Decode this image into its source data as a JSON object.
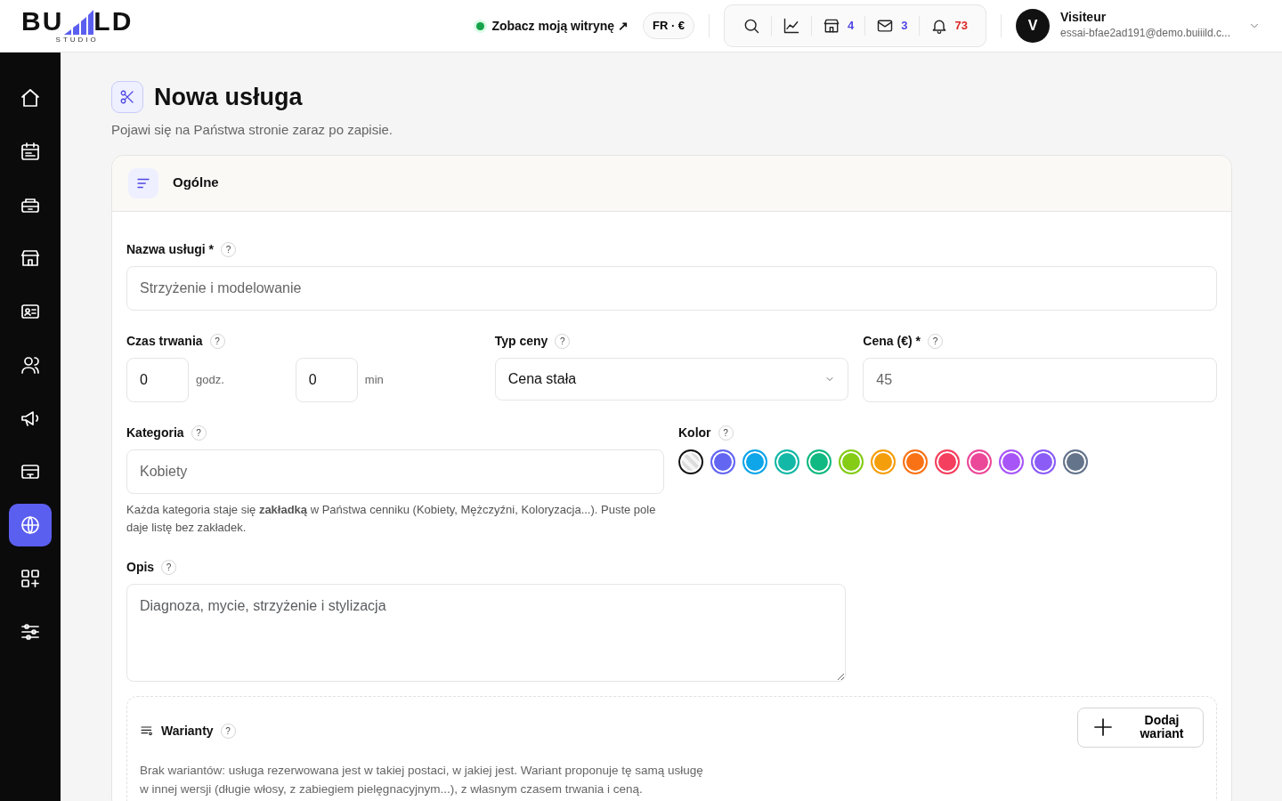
{
  "logo": {
    "left": "BU",
    "right": "LD",
    "sub": "STUDIO"
  },
  "header": {
    "site_link": "Zobacz moją witrynę ↗",
    "site_online": true,
    "locale": "FR · €",
    "toolbar": [
      {
        "count": "4",
        "color": "#4f46e5"
      },
      {
        "count": "3",
        "color": "#4f46e5"
      },
      {
        "count": "73",
        "color": "#dc2626"
      }
    ],
    "user": {
      "initial": "V",
      "name": "Visiteur",
      "email": "essai-bfae2ad191@demo.buiiild.c..."
    }
  },
  "sidebar": {
    "items": [
      {
        "selected": false
      },
      {
        "selected": false
      },
      {
        "selected": false
      },
      {
        "selected": false
      },
      {
        "selected": false
      },
      {
        "selected": false
      },
      {
        "selected": false
      },
      {
        "selected": false
      },
      {
        "selected": true
      },
      {
        "selected": false
      },
      {
        "selected": false
      }
    ]
  },
  "page": {
    "title": "Nowa usługa",
    "subtitle": "Pojawi się na Państwa stronie zaraz po zapisie."
  },
  "section": {
    "title": "Ogólne"
  },
  "form": {
    "name": {
      "label": "Nazwa usługi *",
      "help": "?",
      "placeholder": "Strzyżenie i modelowanie"
    },
    "duration": {
      "label": "Czas trwania",
      "help": "?",
      "hours": "0",
      "hours_unit": "godz.",
      "minutes": "0",
      "minutes_unit": "min"
    },
    "price_type": {
      "label": "Typ ceny",
      "help": "?",
      "value": "Cena stała"
    },
    "price": {
      "label": "Cena (€) *",
      "help": "?",
      "placeholder": "45"
    },
    "category": {
      "label": "Kategoria",
      "help": "?",
      "placeholder": "Kobiety",
      "hint": "Każda kategoria staje się **zakładką** w Państwa cenniku (Kobiety, Mężczyźni, Koloryzacja...). Puste pole daje listę bez zakładek."
    },
    "color": {
      "label": "Kolor",
      "help": "?",
      "swatches": [
        {
          "kind": "none",
          "selected": true
        },
        {
          "kind": "swatch",
          "color": "#6366f1",
          "selected": false
        },
        {
          "kind": "swatch",
          "color": "#0ea5e9",
          "selected": false
        },
        {
          "kind": "swatch",
          "color": "#14b8a6",
          "selected": false
        },
        {
          "kind": "swatch",
          "color": "#10b981",
          "selected": false
        },
        {
          "kind": "swatch",
          "color": "#84cc16",
          "selected": false
        },
        {
          "kind": "swatch",
          "color": "#f59e0b",
          "selected": false
        },
        {
          "kind": "swatch",
          "color": "#f97316",
          "selected": false
        },
        {
          "kind": "swatch",
          "color": "#f43f5e",
          "selected": false
        },
        {
          "kind": "swatch",
          "color": "#ec4899",
          "selected": false
        },
        {
          "kind": "swatch",
          "color": "#a855f7",
          "selected": false
        },
        {
          "kind": "swatch",
          "color": "#8b5cf6",
          "selected": false
        },
        {
          "kind": "swatch",
          "color": "#64748b",
          "selected": false
        }
      ]
    },
    "description": {
      "label": "Opis",
      "help": "?",
      "placeholder": "Diagnoza, mycie, strzyżenie i stylizacja"
    },
    "variants": {
      "title": "Warianty",
      "help": "?",
      "add_button": "Dodaj wariant",
      "empty_text": "Brak wariantów: usługa rezerwowana jest w takiej postaci, w jakiej jest. Wariant proponuje tę samą usługę w innej wersji (długie włosy, z zabiegiem pielęgnacyjnym...), z własnym czasem trwania i ceną."
    }
  }
}
